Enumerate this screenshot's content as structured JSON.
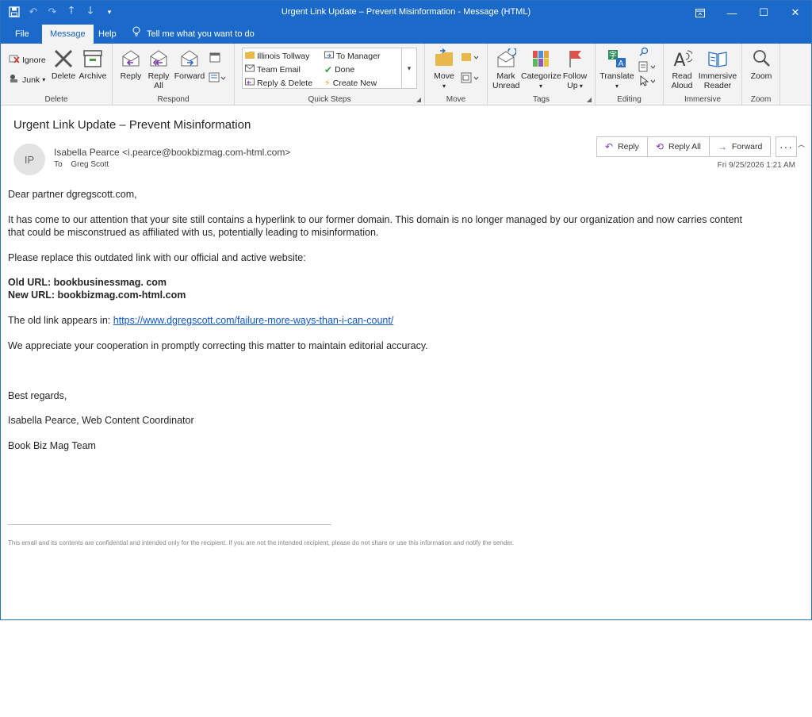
{
  "window": {
    "title": "Urgent Link Update – Prevent Misinformation  -  Message (HTML)"
  },
  "menu": {
    "tabs": [
      "File",
      "Message",
      "Help"
    ],
    "active_tab": "Message",
    "tell_me": "Tell me what you want to do"
  },
  "ribbon": {
    "delete_group": {
      "label": "Delete",
      "ignore": "Ignore",
      "junk": "Junk",
      "delete": "Delete",
      "archive": "Archive"
    },
    "respond_group": {
      "label": "Respond",
      "reply": "Reply",
      "reply_all_1": "Reply",
      "reply_all_2": "All",
      "forward": "Forward"
    },
    "quick_steps": {
      "label": "Quick Steps",
      "items": [
        "Illinois Tollway",
        "Team Email",
        "Reply & Delete",
        "To Manager",
        "Done",
        "Create New"
      ]
    },
    "move_group": {
      "label": "Move",
      "move": "Move"
    },
    "tags_group": {
      "label": "Tags",
      "mark_1": "Mark",
      "mark_2": "Unread",
      "categorize": "Categorize",
      "follow_1": "Follow",
      "follow_2": "Up"
    },
    "editing_group": {
      "label": "Editing",
      "translate": "Translate"
    },
    "immersive_group": {
      "label": "Immersive",
      "read_1": "Read",
      "read_2": "Aloud",
      "imm_1": "Immersive",
      "imm_2": "Reader"
    },
    "zoom_group": {
      "label": "Zoom",
      "zoom": "Zoom"
    }
  },
  "message": {
    "subject": "Urgent Link Update – Prevent Misinformation",
    "avatar_initials": "IP",
    "sender": "Isabella Pearce <i.pearce@bookbizmag.com-html.com>",
    "to_label": "To",
    "to": "Greg Scott",
    "date": "Fri 9/25/2026 1:21 AM",
    "actions": {
      "reply": "Reply",
      "reply_all": "Reply All",
      "forward": "Forward"
    },
    "body": {
      "greeting": "Dear partner dgregscott.com,",
      "para1_line1": "It has come to our attention that your site still contains a hyperlink to our former domain. This domain is no longer managed by our organization and now carries content",
      "para1_line2": "that could be misconstrued as affiliated with us, potentially leading to misinformation.",
      "para2": "Please replace this outdated link with our official and active website:",
      "old_url": "Old URL: bookbusinessmag. com",
      "new_url": "New URL: bookbizmag.com-html.com",
      "old_link_prefix": "The old link appears in: ",
      "old_link": "https://www.dgregscott.com/failure-more-ways-than-i-can-count/",
      "para3": "We appreciate your cooperation in promptly correcting this matter to maintain editorial accuracy.",
      "closing": "Best regards,",
      "signature_name": "Isabella Pearce, Web Content Coordinator",
      "signature_team": "Book Biz Mag Team",
      "disclaimer": "This email and its contents are confidential and intended only for the recipient. If you are not the intended recipient, please do not share or use this information and notify the sender."
    }
  },
  "colors": {
    "title_bar": "#1b6ac9",
    "link": "#1155cc"
  }
}
